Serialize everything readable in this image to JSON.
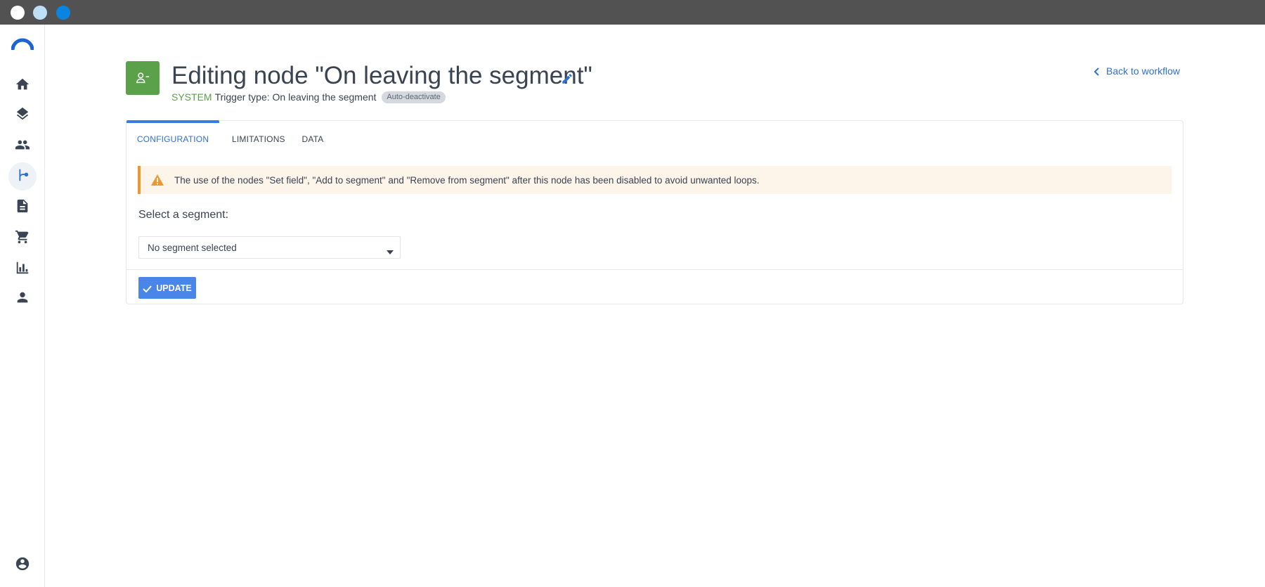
{
  "header": {
    "title": "Editing node \"On leaving the segment\"",
    "system_label": "SYSTEM",
    "trigger_text": "Trigger type: On leaving the segment",
    "badge": "Auto-deactivate",
    "back_link": "Back to workflow"
  },
  "sidebar": {
    "items": [
      {
        "icon": "home-icon"
      },
      {
        "icon": "layers-icon"
      },
      {
        "icon": "people-icon"
      },
      {
        "icon": "workflow-icon",
        "active": true
      },
      {
        "icon": "document-icon"
      },
      {
        "icon": "cart-icon"
      },
      {
        "icon": "bar-chart-icon"
      },
      {
        "icon": "person-icon"
      }
    ],
    "bottom_icon": "account-icon"
  },
  "tabs": [
    {
      "label": "CONFIGURATION",
      "active": true
    },
    {
      "label": "LIMITATIONS",
      "active": false
    },
    {
      "label": "DATA",
      "active": false
    }
  ],
  "alert": {
    "text": "The use of the nodes \"Set field\", \"Add to segment\" and \"Remove from segment\" after this node has been disabled to avoid unwanted loops."
  },
  "form": {
    "segment_label": "Select a segment:",
    "segment_value": "No segment selected"
  },
  "actions": {
    "update_label": "UPDATE"
  },
  "colors": {
    "accent": "#2f6fd6",
    "node_green": "#5aa14a",
    "warning": "#f0962e",
    "button": "#4a86e8"
  }
}
